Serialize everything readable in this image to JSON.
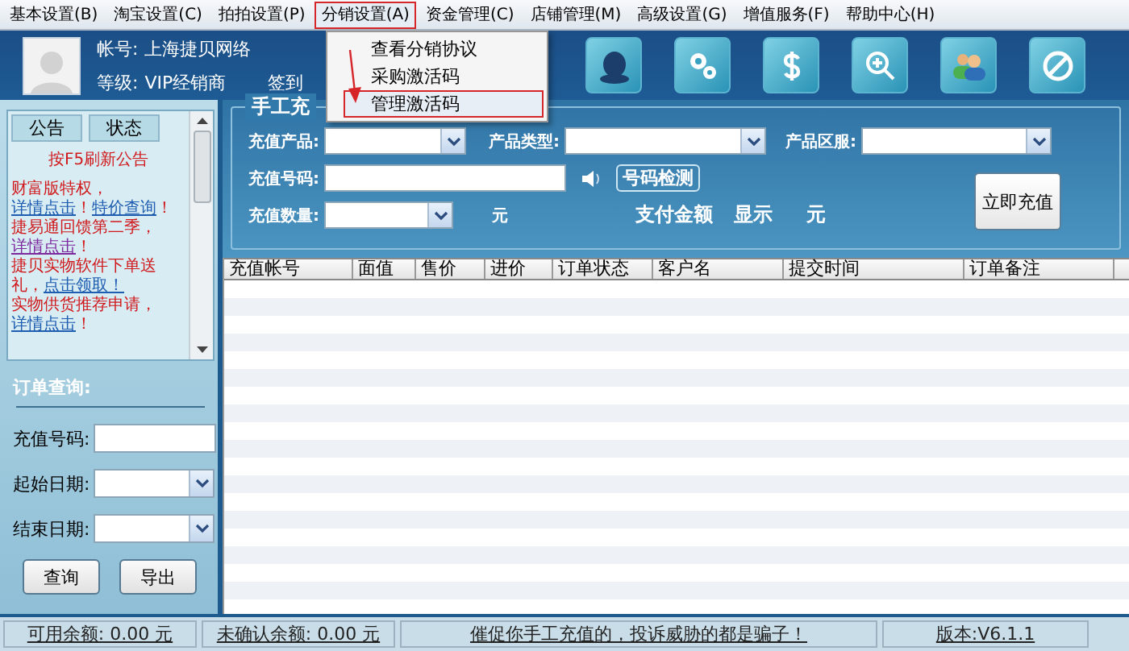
{
  "menu": [
    {
      "label": "基本设置(B)",
      "selected": false
    },
    {
      "label": "淘宝设置(C)",
      "selected": false
    },
    {
      "label": "拍拍设置(P)",
      "selected": false
    },
    {
      "label": "分销设置(A)",
      "selected": true
    },
    {
      "label": "资金管理(C)",
      "selected": false
    },
    {
      "label": "店铺管理(M)",
      "selected": false
    },
    {
      "label": "高级设置(G)",
      "selected": false
    },
    {
      "label": "增值服务(F)",
      "selected": false
    },
    {
      "label": "帮助中心(H)",
      "selected": false
    }
  ],
  "dropdown": {
    "items": [
      {
        "label": "查看分销协议",
        "selected": false
      },
      {
        "label": "采购激活码",
        "selected": false
      },
      {
        "label": "管理激活码",
        "selected": true
      }
    ]
  },
  "account": {
    "label": "帐号:",
    "value": "上海捷贝网络",
    "level_label": "等级:",
    "level_value": "VIP经销商",
    "checkin": "签到"
  },
  "notices": {
    "tabs": [
      {
        "label": "公告",
        "selected": false
      },
      {
        "label": "状态",
        "selected": false
      }
    ],
    "refresh_hint": "按F5刷新公告",
    "items": [
      [
        {
          "text": "财富版特权，",
          "kind": "plain"
        },
        {
          "text": "详情点击",
          "kind": "link",
          "visited": false
        },
        {
          "text": "！",
          "kind": "plain"
        },
        {
          "text": "特价查询",
          "kind": "link",
          "visited": false
        },
        {
          "text": "！",
          "kind": "plain"
        }
      ],
      [
        {
          "text": "捷易通回馈第二季，",
          "kind": "plain"
        },
        {
          "text": "详情点击",
          "kind": "link",
          "visited": true
        },
        {
          "text": "！",
          "kind": "plain"
        }
      ],
      [
        {
          "text": "捷贝实物软件下单送礼，",
          "kind": "plain"
        },
        {
          "text": "点击领取！",
          "kind": "link",
          "visited": false
        }
      ],
      [
        {
          "text": "实物供货推荐申请，",
          "kind": "plain"
        },
        {
          "text": "详情点击",
          "kind": "link",
          "visited": false
        },
        {
          "text": "！",
          "kind": "plain"
        }
      ]
    ]
  },
  "order_query": {
    "title": "订单查询:",
    "fields": [
      {
        "label": "充值号码:",
        "kind": "text"
      },
      {
        "label": "起始日期:",
        "kind": "select"
      },
      {
        "label": "结束日期:",
        "kind": "select"
      }
    ],
    "buttons": [
      "查询",
      "导出"
    ]
  },
  "recharge": {
    "title": "手工充",
    "product_label": "充值产品:",
    "type_label": "产品类型:",
    "region_label": "产品区服:",
    "number_label": "充值号码:",
    "check_button": "号码检测",
    "quantity_label": "充值数量:",
    "quantity_unit": "元",
    "pay_label": "支付金额",
    "pay_value": "显示",
    "pay_unit": "元",
    "submit": "立即充值"
  },
  "table": {
    "columns": [
      "充值帐号",
      "面值",
      "售价",
      "进价",
      "订单状态",
      "客户名",
      "提交时间",
      "订单备注"
    ]
  },
  "status_bar": [
    "可用余额: 0.00 元",
    "未确认余额: 0.00 元",
    "催促你手工充值的，投诉威胁的都是骗子！",
    "版本:V6.1.1"
  ]
}
